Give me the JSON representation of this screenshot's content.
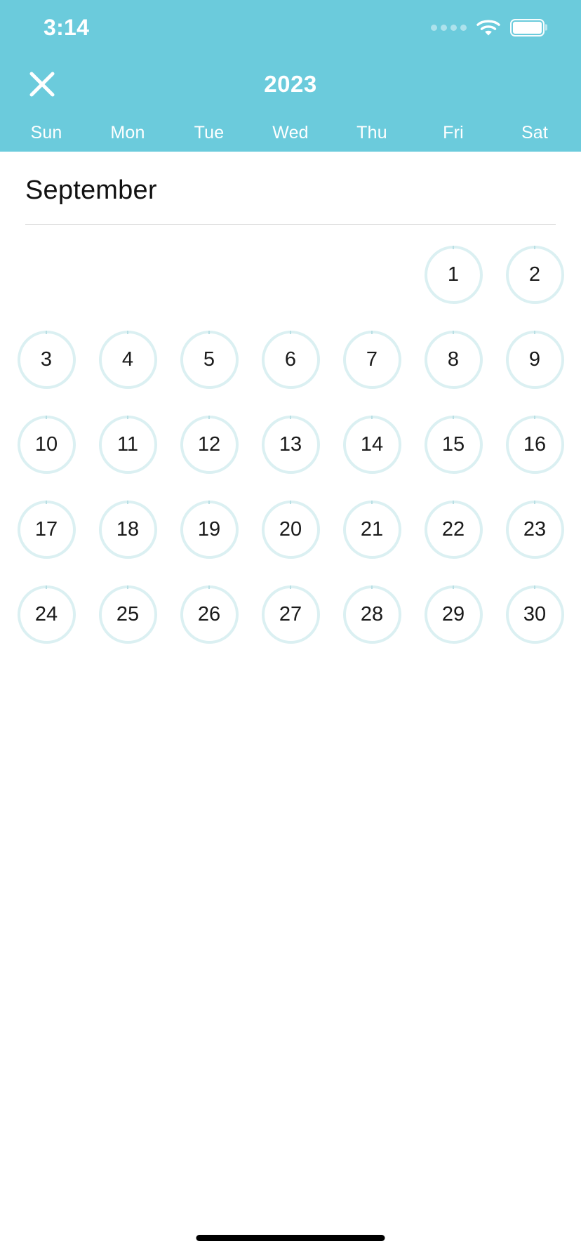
{
  "status_bar": {
    "time": "3:14",
    "signal_dots": 4,
    "wifi_icon": "wifi-icon",
    "battery_icon": "battery-full-icon",
    "battery_level": 100
  },
  "header": {
    "close_icon": "close-icon",
    "year": "2023",
    "background_color": "#6BCBDC",
    "text_color": "#FFFFFF",
    "weekdays": [
      "Sun",
      "Mon",
      "Tue",
      "Wed",
      "Thu",
      "Fri",
      "Sat"
    ]
  },
  "month": {
    "name": "September",
    "year": "2023",
    "first_weekday_index": 5,
    "leading_blanks": 5,
    "ring_color": "#DBF0F2",
    "day_text_color": "#1A1A1A",
    "days": [
      "1",
      "2",
      "3",
      "4",
      "5",
      "6",
      "7",
      "8",
      "9",
      "10",
      "11",
      "12",
      "13",
      "14",
      "15",
      "16",
      "17",
      "18",
      "19",
      "20",
      "21",
      "22",
      "23",
      "24",
      "25",
      "26",
      "27",
      "28",
      "29",
      "30"
    ]
  },
  "home_indicator": {
    "color": "#000000"
  }
}
